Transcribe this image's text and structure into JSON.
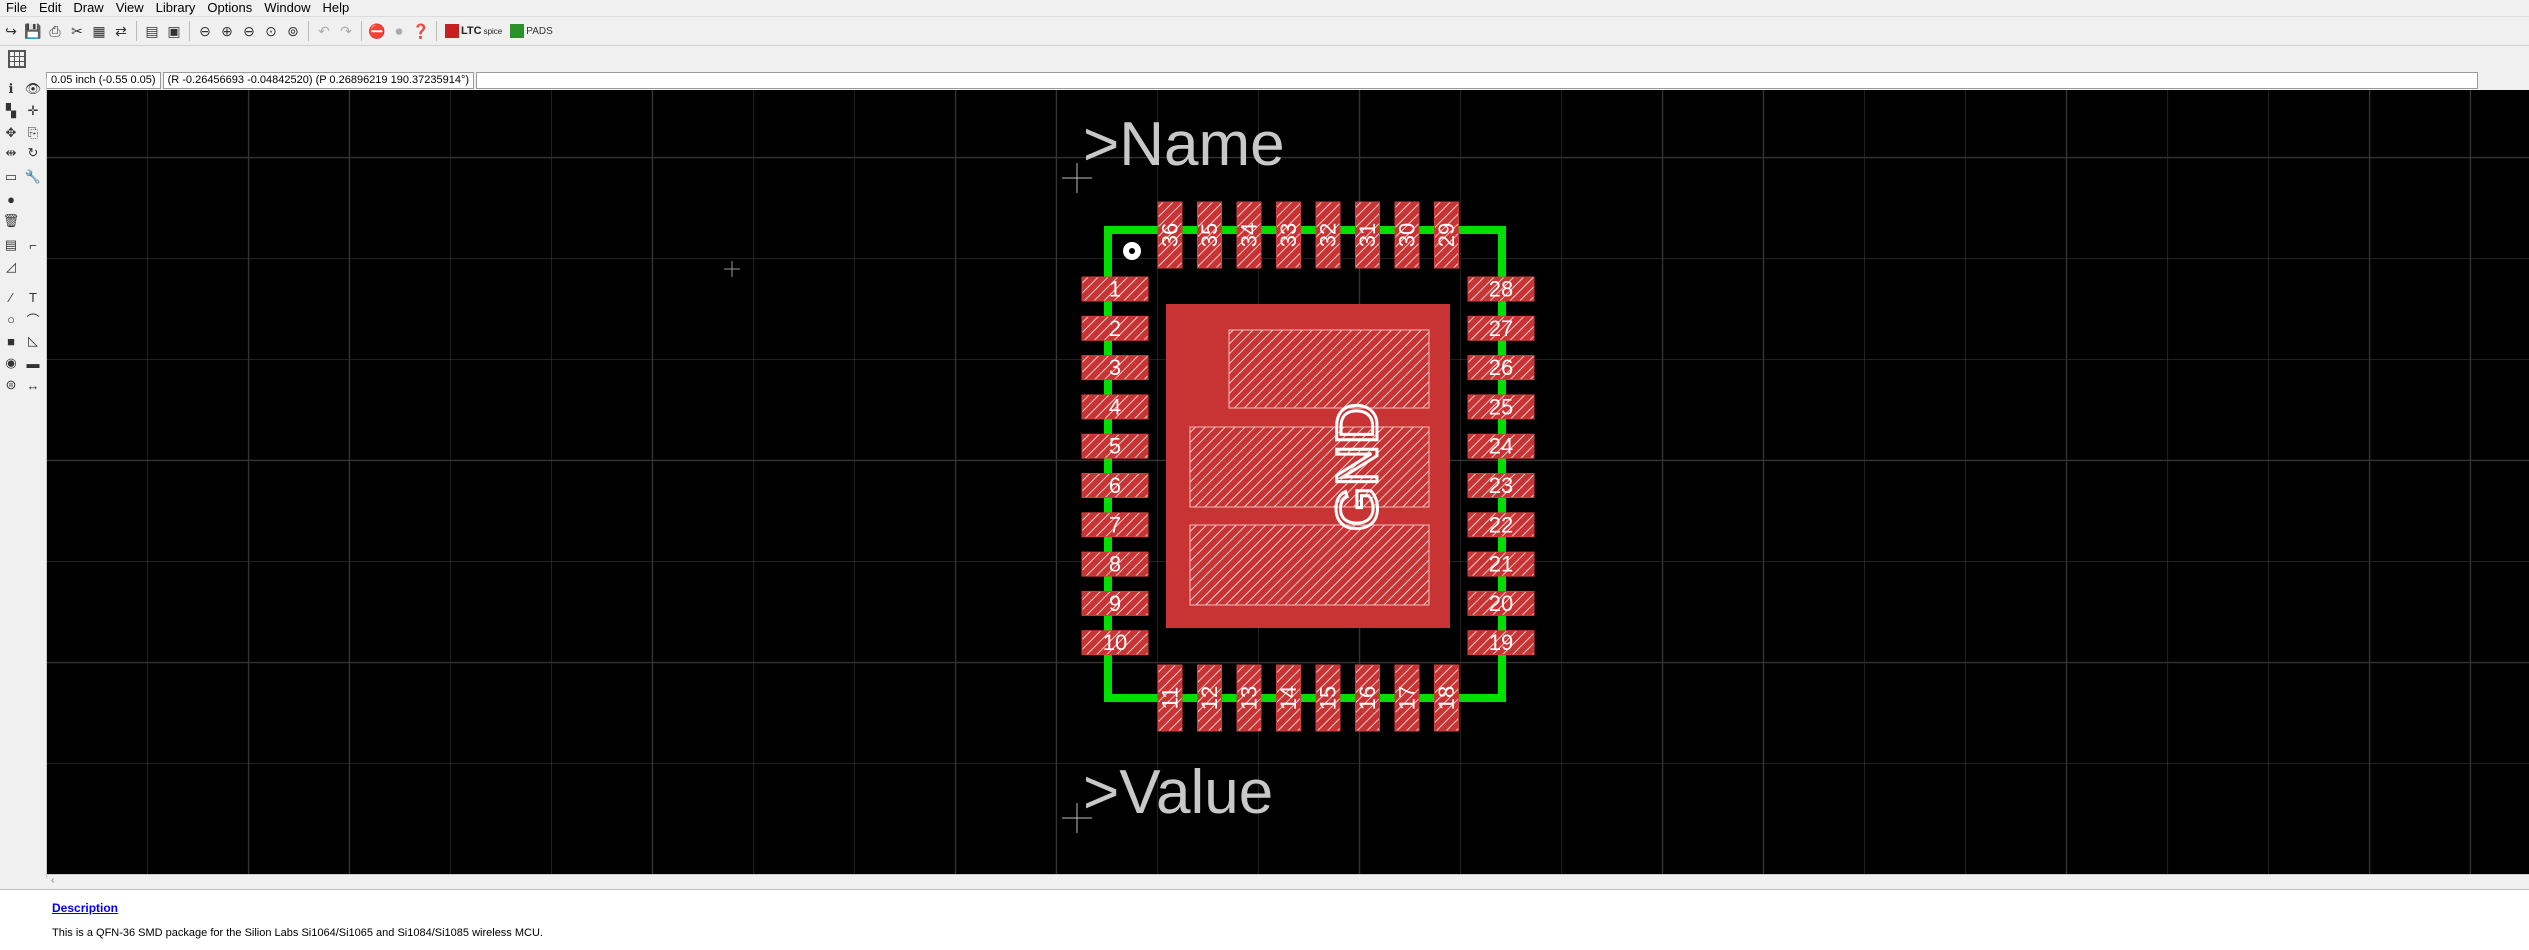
{
  "menu": {
    "items": [
      "File",
      "Edit",
      "Draw",
      "View",
      "Library",
      "Options",
      "Window",
      "Help"
    ]
  },
  "toolbar": {
    "ltc_label": "LTC",
    "ltc_sub": "spice",
    "pads_label": "PADS"
  },
  "status": {
    "grid": "0.05 inch (-0.55 0.05)",
    "coords": "(R -0.26456693 -0.04842520) (P 0.26896219 190.37235914°)",
    "command": ""
  },
  "canvas": {
    "name_label": ">Name",
    "value_label": ">Value",
    "gnd_label": "GND",
    "pad_color": "#d04040",
    "outline_color": "#00e000",
    "background": "#000000",
    "left_pads": [
      "1",
      "2",
      "3",
      "4",
      "5",
      "6",
      "7",
      "8",
      "9",
      "10"
    ],
    "right_pads": [
      "28",
      "27",
      "26",
      "25",
      "24",
      "23",
      "22",
      "21",
      "20",
      "19"
    ],
    "top_pads": [
      "36",
      "35",
      "34",
      "33",
      "32",
      "31",
      "30",
      "29"
    ],
    "bottom_pads": [
      "11",
      "12",
      "13",
      "14",
      "15",
      "16",
      "17",
      "18"
    ]
  },
  "description": {
    "title": "Description",
    "text": "This is a QFN-36 SMD package for the Silion Labs Si1064/Si1065 and Si1084/Si1085 wireless MCU."
  }
}
